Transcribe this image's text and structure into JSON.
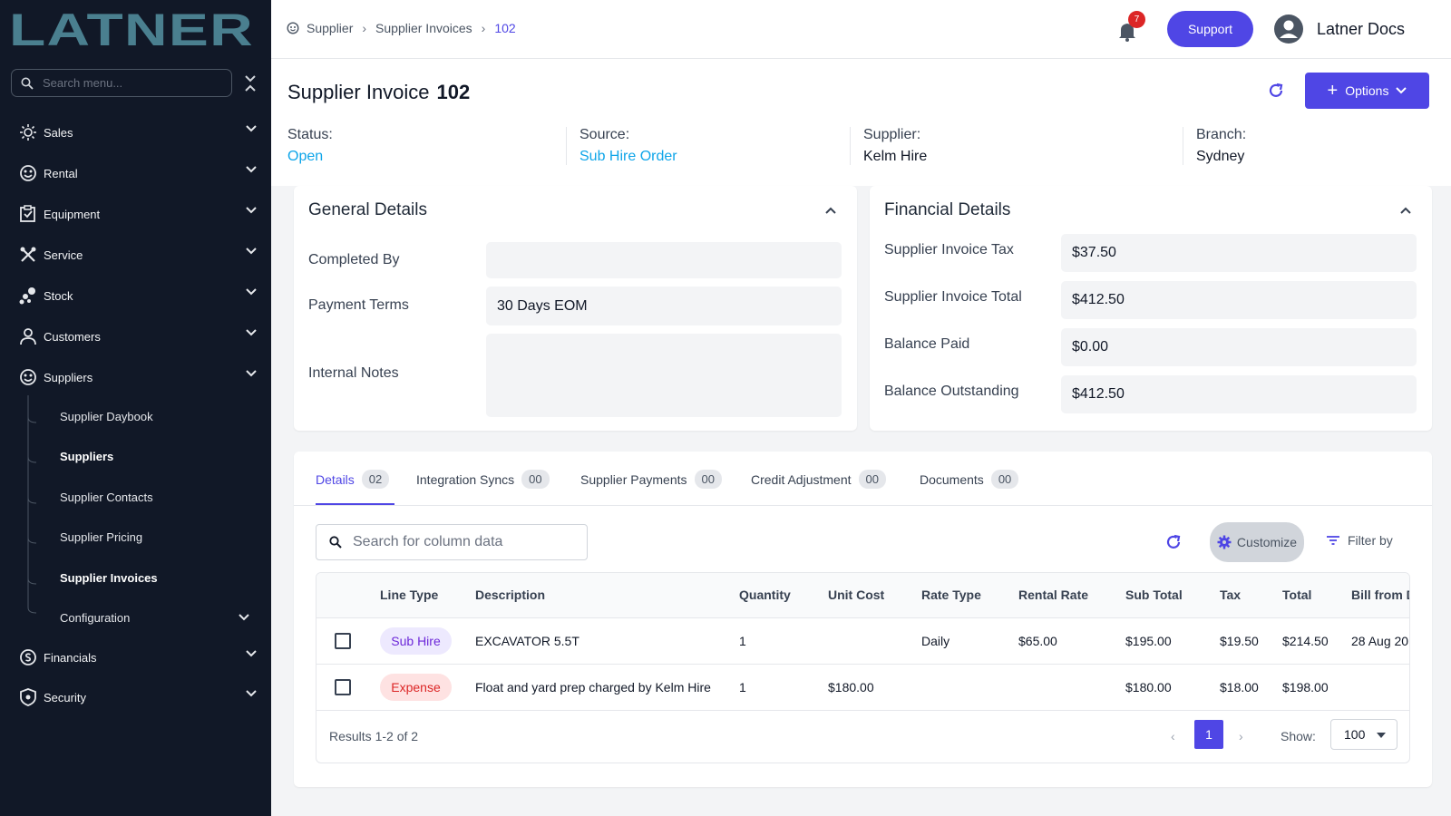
{
  "brand": {
    "logo_text": "LATNER"
  },
  "sidebar": {
    "search_placeholder": "Search menu...",
    "items": [
      {
        "label": "Sales",
        "icon": "sales-icon"
      },
      {
        "label": "Rental",
        "icon": "rental-icon"
      },
      {
        "label": "Equipment",
        "icon": "equipment-icon"
      },
      {
        "label": "Service",
        "icon": "service-icon"
      },
      {
        "label": "Stock",
        "icon": "stock-icon"
      },
      {
        "label": "Customers",
        "icon": "customers-icon"
      },
      {
        "label": "Suppliers",
        "icon": "suppliers-icon"
      },
      {
        "label": "Financials",
        "icon": "financials-icon"
      },
      {
        "label": "Security",
        "icon": "security-icon"
      }
    ],
    "suppliers_sub": [
      "Supplier Daybook",
      "Suppliers",
      "Supplier Contacts",
      "Supplier Pricing",
      "Supplier Invoices",
      "Configuration"
    ]
  },
  "breadcrumb": {
    "root": "Supplier",
    "parent": "Supplier Invoices",
    "current": "102"
  },
  "topbar": {
    "notification_count": "7",
    "support_label": "Support",
    "user_name": "Latner Docs"
  },
  "header": {
    "title": "Supplier Invoice",
    "number": "102",
    "options_label": "Options",
    "status_label": "Status:",
    "status_value": "Open",
    "source_label": "Source:",
    "source_value": "Sub Hire Order",
    "supplier_label": "Supplier:",
    "supplier_value": "Kelm Hire",
    "branch_label": "Branch:",
    "branch_value": "Sydney"
  },
  "general": {
    "title": "General Details",
    "completed_by_label": "Completed By",
    "completed_by_value": "",
    "payment_terms_label": "Payment Terms",
    "payment_terms_value": "30 Days EOM",
    "internal_notes_label": "Internal Notes",
    "internal_notes_value": ""
  },
  "financial": {
    "title": "Financial Details",
    "tax_label": "Supplier Invoice Tax",
    "tax_value": "$37.50",
    "total_label": "Supplier Invoice Total",
    "total_value": "$412.50",
    "paid_label": "Balance Paid",
    "paid_value": "$0.00",
    "outstanding_label": "Balance Outstanding",
    "outstanding_value": "$412.50"
  },
  "tabs": [
    {
      "label": "Details",
      "count": "02"
    },
    {
      "label": "Integration Syncs",
      "count": "00"
    },
    {
      "label": "Supplier Payments",
      "count": "00"
    },
    {
      "label": "Credit Adjustment",
      "count": "00"
    },
    {
      "label": "Documents",
      "count": "00"
    }
  ],
  "table": {
    "search_placeholder": "Search for column data",
    "customize_label": "Customize",
    "filter_label": "Filter by",
    "columns": [
      "Line Type",
      "Description",
      "Quantity",
      "Unit Cost",
      "Rate Type",
      "Rental Rate",
      "Sub Total",
      "Tax",
      "Total",
      "Bill from D"
    ],
    "rows": [
      {
        "line_type": "Sub Hire",
        "description": "EXCAVATOR 5.5T",
        "quantity": "1",
        "unit_cost": "",
        "rate_type": "Daily",
        "rental_rate": "$65.00",
        "sub_total": "$195.00",
        "tax": "$19.50",
        "total": "$214.50",
        "bill_from": "28 Aug 20"
      },
      {
        "line_type": "Expense",
        "description": "Float and yard prep charged by Kelm Hire",
        "quantity": "1",
        "unit_cost": "$180.00",
        "rate_type": "",
        "rental_rate": "",
        "sub_total": "$180.00",
        "tax": "$18.00",
        "total": "$198.00",
        "bill_from": ""
      }
    ],
    "results_text": "Results 1-2 of 2",
    "current_page": "1",
    "show_label": "Show:",
    "page_size": "100"
  },
  "colors": {
    "accent": "#4f46e5",
    "sidebar_bg": "#111827",
    "link": "#0ea5e9",
    "logo": "#4a7f8f"
  }
}
